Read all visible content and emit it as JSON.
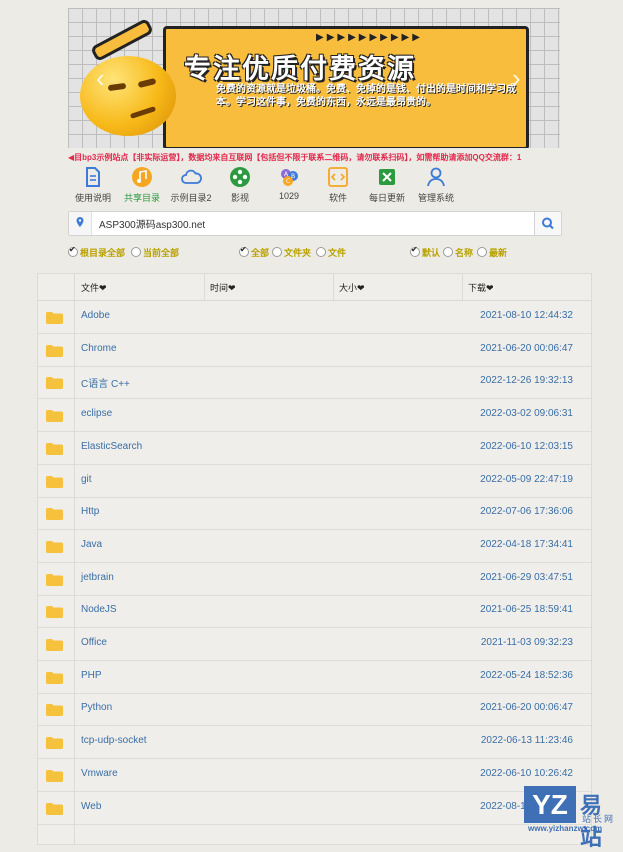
{
  "banner": {
    "title": "专注优质付费资源",
    "subtitle": "免费的资源就是垃圾桶。免费、免掉的是钱、付出的是时间和学习成本。学习这件事，免费的东西，永远是最昂贵的。",
    "prev_glyph": "‹",
    "next_glyph": "›"
  },
  "notice": "◀目bp3示例站点【非实际运营】，数据均来自互联网【包括但不限于联系二维码，请勿联系扫码】，如需帮助请添加QQ交流群：1",
  "nav": [
    {
      "label": "使用说明",
      "icon": "document-icon",
      "color": "#3d7bd8"
    },
    {
      "label": "共享目录",
      "icon": "music-note-icon",
      "color": "#f5a623"
    },
    {
      "label": "示例目录2",
      "icon": "cloud-icon",
      "color": "#3d7bd8"
    },
    {
      "label": "影视",
      "icon": "film-reel-icon",
      "color": "#2c9a3e"
    },
    {
      "label": "1029",
      "icon": "abc-icon",
      "color": "#8e6ad8"
    },
    {
      "label": "软件",
      "icon": "code-icon",
      "color": "#f5a623"
    },
    {
      "label": "每日更新",
      "icon": "excel-icon",
      "color": "#2c9a3e"
    },
    {
      "label": "管理系统",
      "icon": "user-icon",
      "color": "#3d7bd8"
    }
  ],
  "search": {
    "value": "ASP300源码asp300.net"
  },
  "filters": {
    "scope": [
      "根目录全部",
      "当前全部"
    ],
    "type": [
      "全部",
      "文件夹",
      "文件"
    ],
    "sort": [
      "默认",
      "名称",
      "最新"
    ]
  },
  "table": {
    "headers": {
      "name": "文件",
      "time": "时间",
      "size": "大小",
      "download": "下载"
    },
    "sort_glyph": "❤",
    "rows": [
      {
        "name": "Adobe",
        "date": "2021-08-10 12:44:32"
      },
      {
        "name": "Chrome",
        "date": "2021-06-20 00:06:47"
      },
      {
        "name": "C语言 C++",
        "date": "2022-12-26 19:32:13"
      },
      {
        "name": "eclipse",
        "date": "2022-03-02 09:06:31"
      },
      {
        "name": "ElasticSearch",
        "date": "2022-06-10 12:03:15"
      },
      {
        "name": "git",
        "date": "2022-05-09 22:47:19"
      },
      {
        "name": "Http",
        "date": "2022-07-06 17:36:06"
      },
      {
        "name": "Java",
        "date": "2022-04-18 17:34:41"
      },
      {
        "name": "jetbrain",
        "date": "2021-06-29 03:47:51"
      },
      {
        "name": "NodeJS",
        "date": "2021-06-25 18:59:41"
      },
      {
        "name": "Office",
        "date": "2021-11-03 09:32:23"
      },
      {
        "name": "PHP",
        "date": "2022-05-24 18:52:36"
      },
      {
        "name": "Python",
        "date": "2021-06-20 00:06:47"
      },
      {
        "name": "tcp-udp-socket",
        "date": "2022-06-13 11:23:46"
      },
      {
        "name": "Vmware",
        "date": "2022-06-10 10:26:42"
      },
      {
        "name": "Web",
        "date": "2022-08-18 19:47:07"
      }
    ]
  },
  "watermark": {
    "logo": "YZ",
    "cn": "易站",
    "cn2": "站长网",
    "url": "www.yizhanzw.com"
  },
  "colors": {
    "link": "#3a6ea5",
    "filter": "#b9a100",
    "notice": "#e2294d",
    "folder": "#f6c23e"
  }
}
